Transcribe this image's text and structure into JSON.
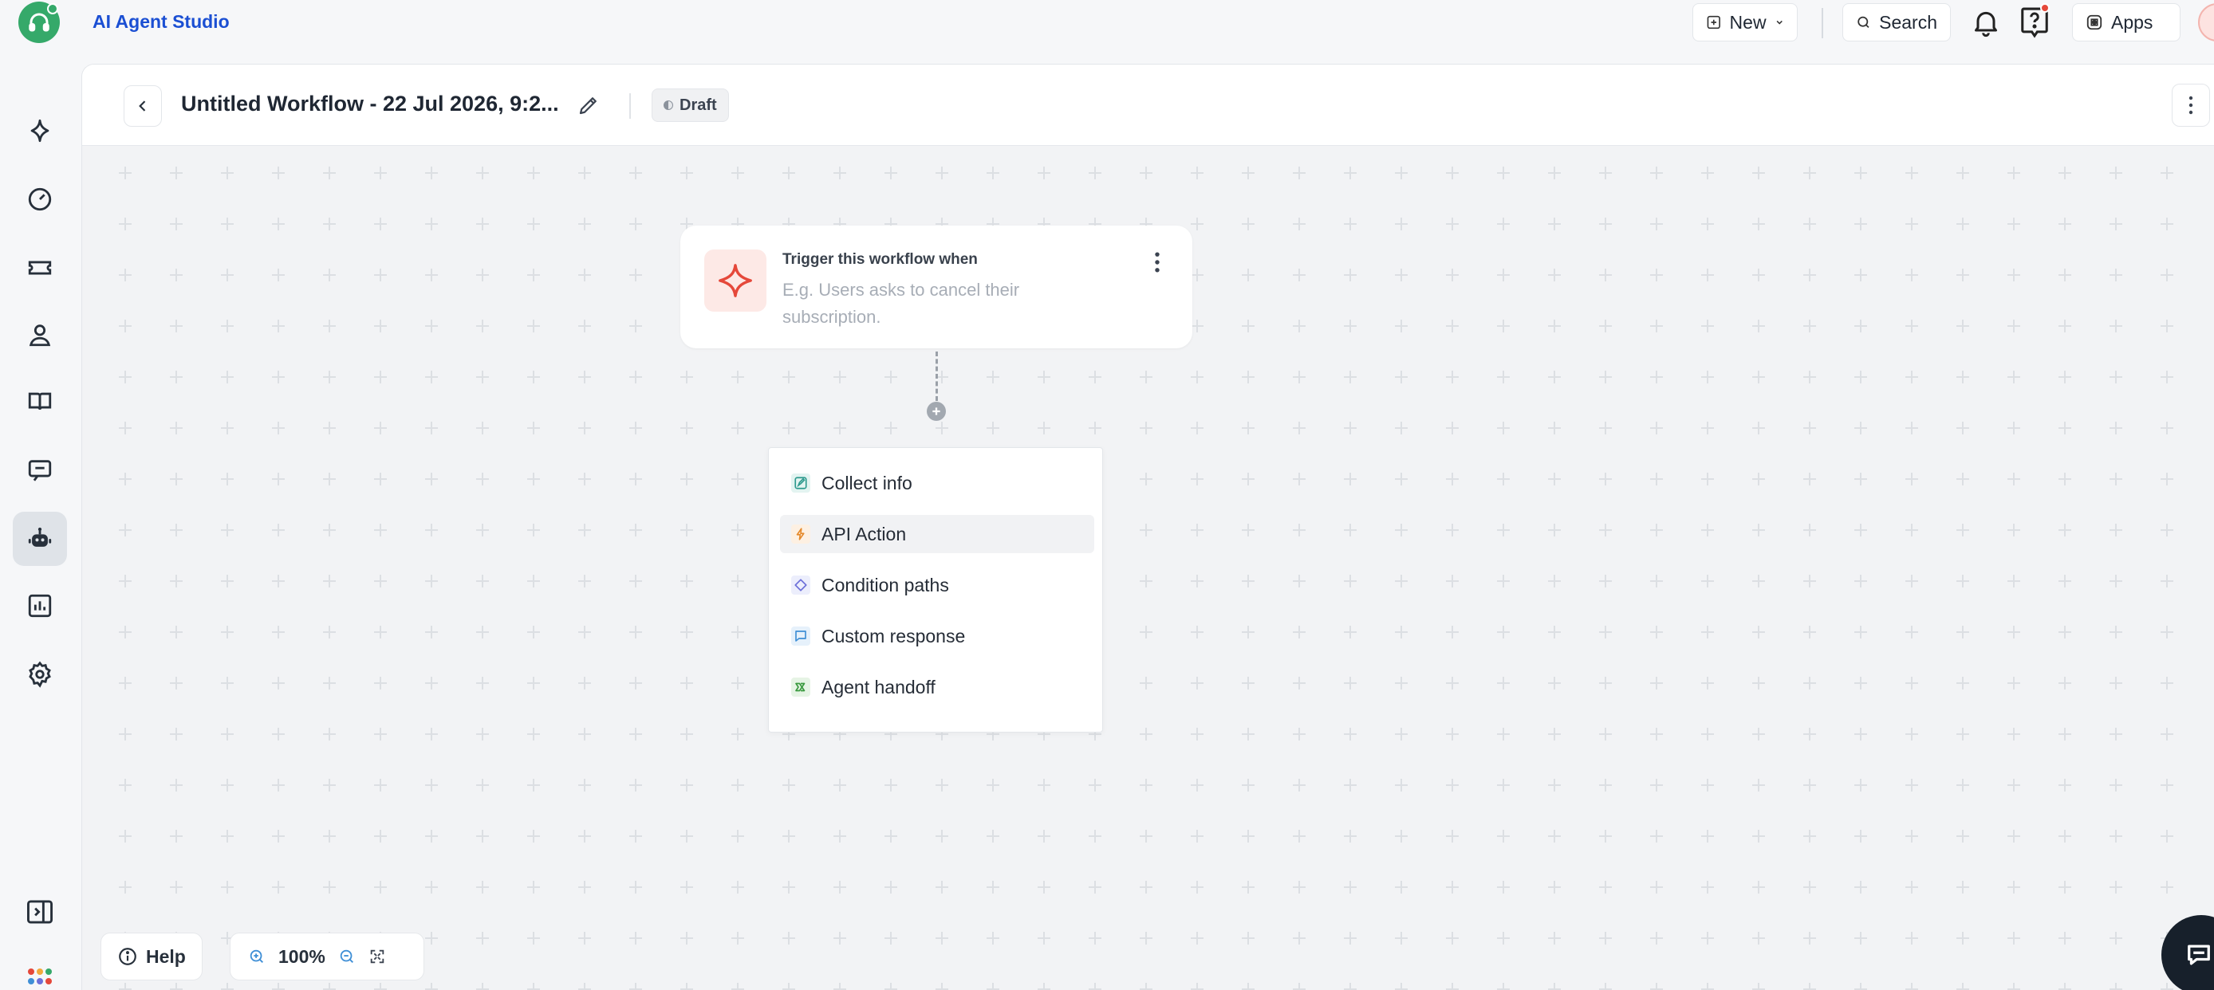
{
  "app": {
    "title": "AI Agent Studio",
    "accent": "#1b4fd3",
    "brand_color": "#35a96a"
  },
  "topbar": {
    "new_label": "New",
    "search_label": "Search",
    "apps_label": "Apps"
  },
  "rail": {
    "items": [
      {
        "icon": "sparkle-icon"
      },
      {
        "icon": "dashboard-gauge-icon"
      },
      {
        "icon": "ticket-icon"
      },
      {
        "icon": "contact-person-icon"
      },
      {
        "icon": "knowledge-book-icon"
      },
      {
        "icon": "conversation-icon"
      },
      {
        "icon": "ai-bot-icon",
        "active": true
      },
      {
        "icon": "analytics-chart-icon"
      },
      {
        "icon": "settings-gear-icon"
      }
    ]
  },
  "workflow": {
    "title": "Untitled Workflow - 22 Jul 2026, 9:2...",
    "status": "Draft"
  },
  "trigger": {
    "label": "Trigger this workflow when",
    "placeholder": "E.g. Users asks to cancel their subscription."
  },
  "menu": {
    "items": [
      {
        "label": "Collect info",
        "icon": "collect-info-icon",
        "color": "#2e9a8e"
      },
      {
        "label": "API Action",
        "icon": "api-action-icon",
        "color": "#e58a2c",
        "hover": true
      },
      {
        "label": "Condition paths",
        "icon": "condition-paths-icon",
        "color": "#6c6fd9"
      },
      {
        "label": "Custom response",
        "icon": "custom-response-icon",
        "color": "#3f8fd6"
      },
      {
        "label": "Agent handoff",
        "icon": "agent-handoff-icon",
        "color": "#3a9a3f"
      }
    ]
  },
  "controls": {
    "help_label": "Help",
    "zoom": "100%"
  }
}
